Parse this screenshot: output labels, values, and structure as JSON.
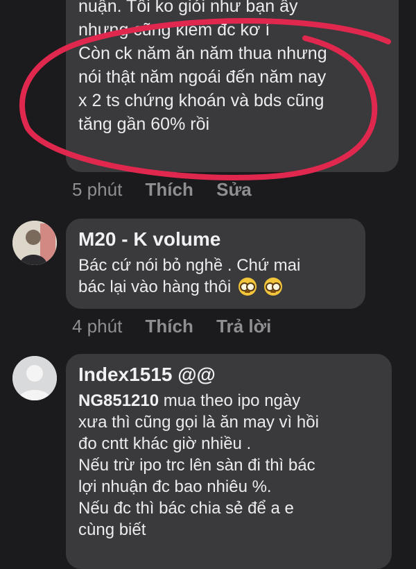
{
  "comments": [
    {
      "lines": [
        "nuận. Tôi ko giỏi như bạn ấy",
        "nhưng cũng kiếm đc kơ í",
        "Còn ck năm ăn năm thua nhưng",
        "nói thật năm ngoái đến năm nay",
        "x 2 ts chứng khoán và bds cũng",
        "tăng gần 60% rồi"
      ],
      "time": "5 phút",
      "like": "Thích",
      "action": "Sửa"
    },
    {
      "author": "M20 - K volume",
      "lines": [
        "Bác cứ nói bỏ nghề . Chứ mai",
        "bác lại vào hàng thôi"
      ],
      "emoji": "nerd-face-emoji",
      "time": "4 phút",
      "like": "Thích",
      "action": "Trả lời"
    },
    {
      "author": "Index1515 @@",
      "mention": "NG851210",
      "first_line": " mua theo ipo ngày",
      "lines": [
        "xưa thì cũng gọi là ăn may vì hồi",
        "đo cntt khác giờ nhiều .",
        "Nếu trừ ipo trc lên sàn đi thì bác",
        "lợi nhuận đc bao nhiêu %.",
        "Nếu đc thì bác chia sẻ để a e",
        "cùng biết"
      ]
    }
  ],
  "colors": {
    "background": "#1b1b1d",
    "bubble": "#3a3a3d",
    "highlight_circle": "#e0284f",
    "muted_text": "#8e8e93"
  }
}
